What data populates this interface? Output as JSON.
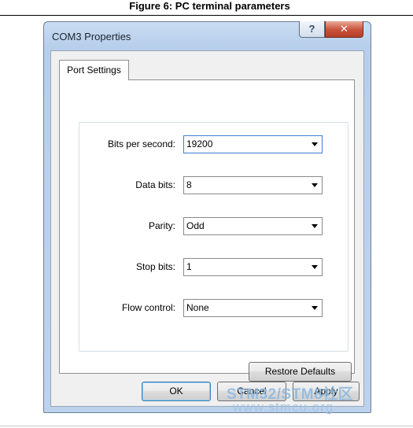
{
  "caption": "Figure 6: PC terminal parameters",
  "window": {
    "title": "COM3 Properties",
    "help_symbol": "?",
    "close_symbol": "✕"
  },
  "tabs": [
    {
      "label": "Port Settings",
      "selected": true
    }
  ],
  "settings": [
    {
      "label": "Bits per second:",
      "value": "19200"
    },
    {
      "label": "Data bits:",
      "value": "8"
    },
    {
      "label": "Parity:",
      "value": "Odd"
    },
    {
      "label": "Stop bits:",
      "value": "1"
    },
    {
      "label": "Flow control:",
      "value": "None"
    }
  ],
  "buttons": {
    "restore_defaults": "Restore Defaults",
    "ok": "OK",
    "cancel": "Cancel",
    "apply": "Apply"
  },
  "watermark": {
    "line1": "STM32/STM8社区",
    "line2": "www.stmcu.org"
  }
}
